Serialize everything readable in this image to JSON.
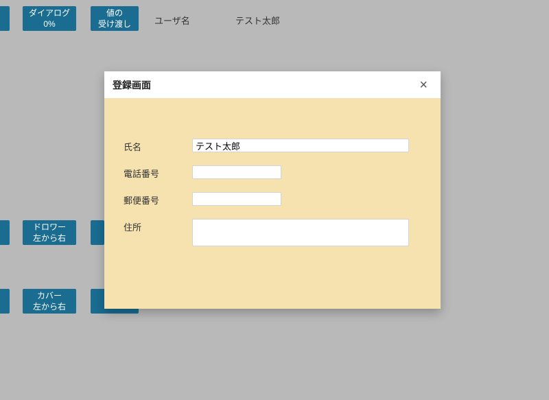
{
  "bg": {
    "buttons": {
      "dialog0": "ダイアログ\n0%",
      "valuePassing": "値の\n受け渡し",
      "drawerLtr": "ドロワー\n左から右",
      "coverLtr": "カバー\n左から右"
    },
    "labels": {
      "userNameLabel": "ユーザ名",
      "userNameValue": "テスト太郎"
    }
  },
  "modal": {
    "title": "登録画面",
    "closeGlyph": "×",
    "fields": {
      "nameLabel": "氏名",
      "nameValue": "テスト太郎",
      "telLabel": "電話番号",
      "telValue": "",
      "zipLabel": "郵便番号",
      "zipValue": "",
      "addressLabel": "住所",
      "addressValue": ""
    }
  }
}
